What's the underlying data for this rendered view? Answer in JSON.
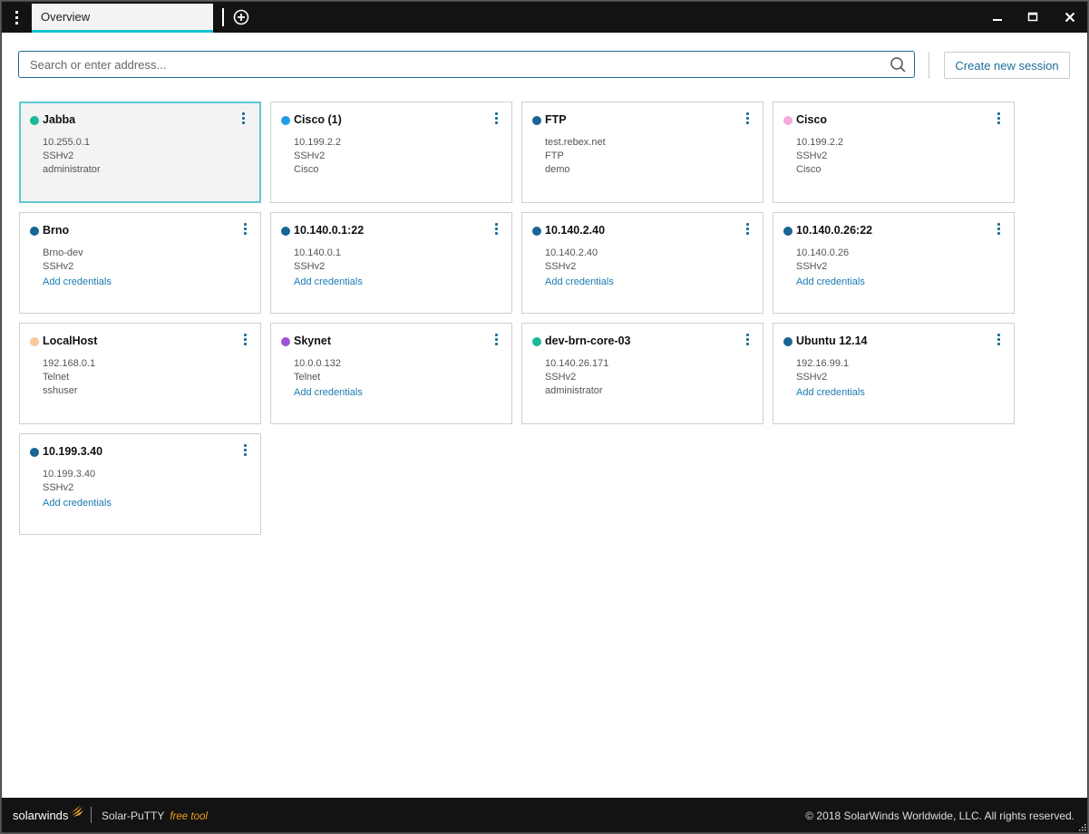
{
  "titlebar": {
    "tabs": [
      {
        "label": "Overview",
        "active": true
      }
    ],
    "menu_icon": "kebab-menu-icon",
    "add_tab_icon": "plus-circle-icon",
    "window_controls": [
      "minimize",
      "maximize",
      "close"
    ]
  },
  "toolbar": {
    "search_placeholder": "Search or enter address...",
    "search_value": "",
    "search_icon": "search-icon",
    "create_label": "Create new session"
  },
  "colors": {
    "accent": "#12c2cf",
    "link": "#1a7bb0",
    "selected_border": "#5fc8d2",
    "titlebar_bg": "#131313"
  },
  "sessions": [
    {
      "name": "Jabba",
      "color": "#1bb99a",
      "lines": [
        "10.255.0.1",
        "SSHv2",
        "administrator"
      ],
      "link": null,
      "selected": true
    },
    {
      "name": "Cisco (1)",
      "color": "#1e9ce8",
      "lines": [
        "10.199.2.2",
        "SSHv2",
        "Cisco"
      ],
      "link": null
    },
    {
      "name": "FTP",
      "color": "#1a6496",
      "lines": [
        "test.rebex.net",
        "FTP",
        "demo"
      ],
      "link": null
    },
    {
      "name": "Cisco",
      "color": "#f7a8dc",
      "lines": [
        "10.199.2.2",
        "SSHv2",
        "Cisco"
      ],
      "link": null
    },
    {
      "name": "Brno",
      "color": "#1a6496",
      "lines": [
        "Brno-dev",
        "SSHv2"
      ],
      "link": "Add credentials"
    },
    {
      "name": "10.140.0.1:22",
      "color": "#1a6496",
      "lines": [
        "10.140.0.1",
        "SSHv2"
      ],
      "link": "Add credentials"
    },
    {
      "name": "10.140.2.40",
      "color": "#1a6496",
      "lines": [
        "10.140.2.40",
        "SSHv2"
      ],
      "link": "Add credentials"
    },
    {
      "name": "10.140.0.26:22",
      "color": "#1a6496",
      "lines": [
        "10.140.0.26",
        "SSHv2"
      ],
      "link": "Add credentials"
    },
    {
      "name": "LocalHost",
      "color": "#fcc89b",
      "lines": [
        "192.168.0.1",
        "Telnet",
        "sshuser"
      ],
      "link": null
    },
    {
      "name": "Skynet",
      "color": "#9b55d6",
      "lines": [
        "10.0.0.132",
        "Telnet"
      ],
      "link": "Add credentials"
    },
    {
      "name": "dev-brn-core-03",
      "color": "#1bb99a",
      "lines": [
        "10.140.26.171",
        "SSHv2",
        "administrator"
      ],
      "link": null
    },
    {
      "name": "Ubuntu 12.14",
      "color": "#1a6496",
      "lines": [
        "192.16.99.1",
        "SSHv2"
      ],
      "link": "Add credentials"
    },
    {
      "name": "10.199.3.40",
      "color": "#1a6496",
      "lines": [
        "10.199.3.40",
        "SSHv2"
      ],
      "link": "Add credentials"
    }
  ],
  "footer": {
    "brand": "solarwinds",
    "product": "Solar-PuTTY",
    "product_tag": "free tool",
    "copyright": "© 2018 SolarWinds Worldwide, LLC. All rights reserved."
  }
}
